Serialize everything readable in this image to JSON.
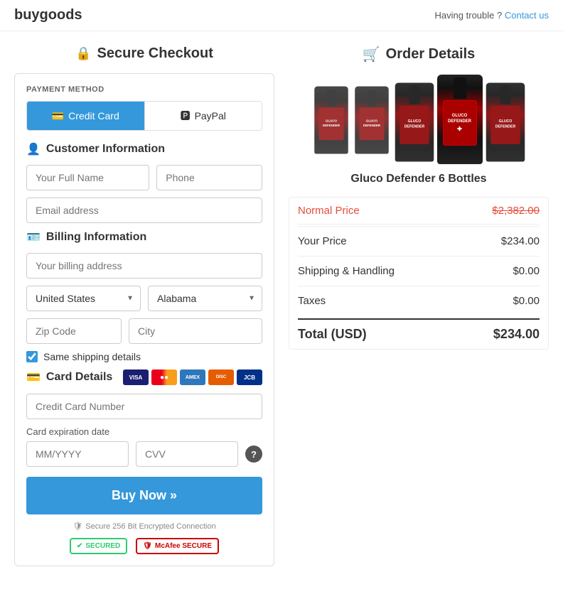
{
  "topbar": {
    "logo": "buygoods",
    "trouble_text": "Having trouble ?",
    "contact_text": "Contact us"
  },
  "left": {
    "section_title": "Secure Checkout",
    "section_icon": "🔒",
    "payment_method_label": "PAYMENT METHOD",
    "tabs": [
      {
        "id": "credit-card",
        "label": "Credit Card",
        "icon": "💳",
        "active": true
      },
      {
        "id": "paypal",
        "label": "PayPal",
        "icon": "🅿",
        "active": false
      }
    ],
    "customer_section": {
      "title": "Customer Information",
      "icon": "👤",
      "full_name_placeholder": "Your Full Name",
      "phone_placeholder": "Phone",
      "email_placeholder": "Email address"
    },
    "billing_section": {
      "title": "Billing Information",
      "icon": "🪪",
      "address_placeholder": "Your billing address",
      "country_label": "United States",
      "state_label": "Alabama",
      "zip_placeholder": "Zip Code",
      "city_placeholder": "City",
      "same_shipping_label": "Same shipping details"
    },
    "card_section": {
      "title": "Card Details",
      "card_number_placeholder": "Credit Card Number",
      "expiry_label": "Card expiration date",
      "expiry_placeholder": "MM/YYYY",
      "cvv_placeholder": "CVV"
    },
    "buy_btn_label": "Buy Now »",
    "secure_text": "Secure 256 Bit Encrypted Connection",
    "badges": [
      {
        "label": "✔ SECURED",
        "type": "green"
      },
      {
        "label": "McAfee SECURE",
        "type": "red"
      }
    ]
  },
  "right": {
    "section_title": "Order Details",
    "section_icon": "🛒",
    "product_name": "Gluco Defender 6 Bottles",
    "normal_price_label": "Normal Price",
    "normal_price_value": "$2,382.00",
    "your_price_label": "Your Price",
    "your_price_value": "$234.00",
    "shipping_label": "Shipping & Handling",
    "shipping_value": "$0.00",
    "taxes_label": "Taxes",
    "taxes_value": "$0.00",
    "total_label": "Total (USD)",
    "total_value": "$234.00"
  }
}
